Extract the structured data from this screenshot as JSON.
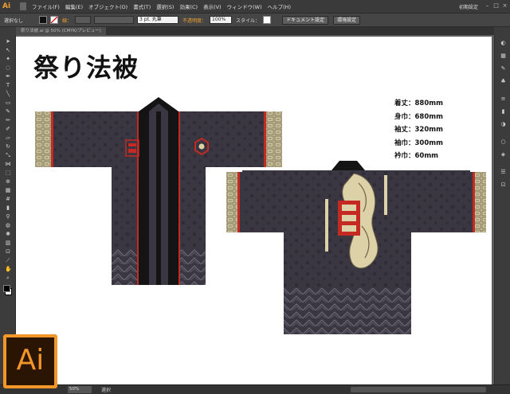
{
  "app": {
    "logo_small": "Ai",
    "logo_large": "Ai",
    "workspace": "初期設定",
    "menus": [
      "ファイル(F)",
      "編集(E)",
      "オブジェクト(O)",
      "書式(T)",
      "選択(S)",
      "効果(C)",
      "表示(V)",
      "ウィンドウ(W)",
      "ヘルプ(H)"
    ]
  },
  "control": {
    "selection_label": "選択なし",
    "stroke_label": "線：",
    "brush_value": "3 pt. 丸筆",
    "opacity_label": "不透明度：",
    "opacity_value": "100%",
    "style_label": "スタイル：",
    "doc_settings_button": "ドキュメント設定",
    "prefs_button": "環境設定"
  },
  "document": {
    "tab_label": "祭り法被.ai @ 50% (CMYK/プレビュー)"
  },
  "artwork": {
    "title": "祭り法被",
    "specs": [
      "着丈：880mm",
      "身巾：680mm",
      "袖丈：320mm",
      "袖巾：300mm",
      "衿巾：60mm"
    ]
  },
  "status": {
    "zoom": "50%",
    "tool": "選択"
  },
  "colors": {
    "fabric": "#3a3742",
    "red": "#c42a22",
    "black": "#141414",
    "cream": "#ddd1a8",
    "accent_orange": "#f3962a"
  }
}
